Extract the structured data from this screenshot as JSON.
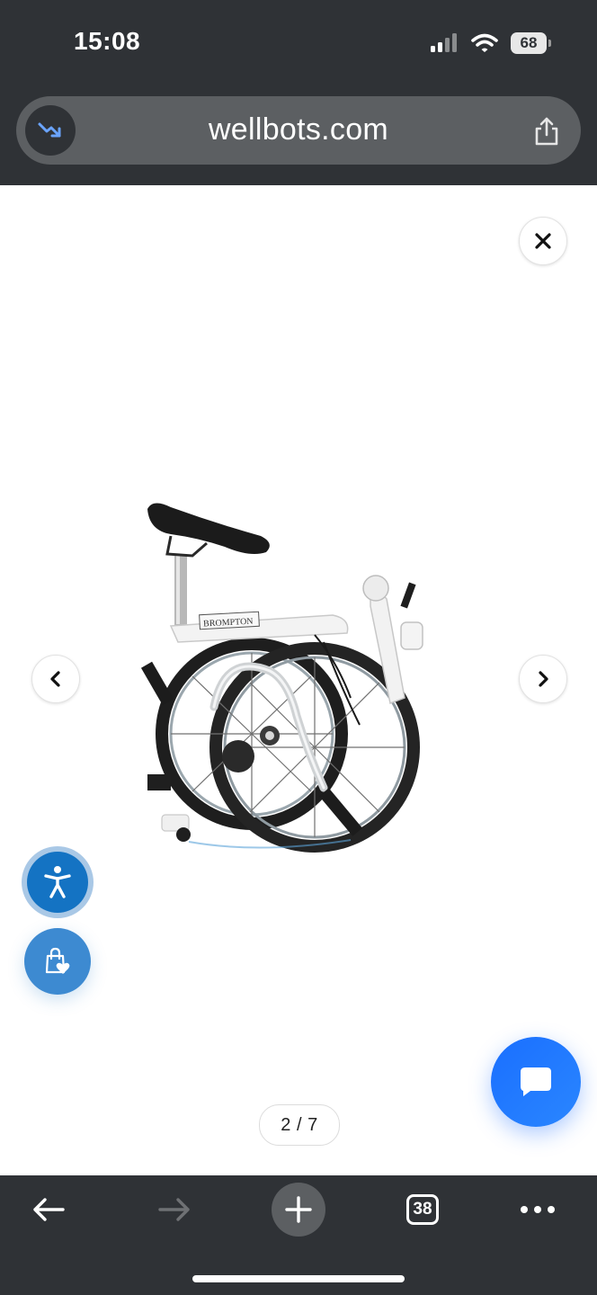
{
  "status_bar": {
    "time": "15:08",
    "battery": "68",
    "signal_icon": "cellular-signal-icon",
    "wifi_icon": "wifi-icon"
  },
  "browser": {
    "url": "wellbots.com",
    "trend_icon": "trending-down-icon",
    "share_icon": "share-icon"
  },
  "gallery": {
    "counter": "2 / 7",
    "brand_label": "BROMPTON",
    "close_icon": "close-icon",
    "prev_icon": "chevron-left-icon",
    "next_icon": "chevron-right-icon"
  },
  "floating": {
    "accessibility_icon": "accessibility-icon",
    "wishlist_icon": "shopping-bag-heart-icon",
    "chat_icon": "chat-bubble-icon"
  },
  "bottom_bar": {
    "tabs_count": "38",
    "back_icon": "arrow-left-icon",
    "forward_icon": "arrow-right-icon",
    "new_tab_icon": "plus-icon",
    "more_icon": "more-horizontal-icon"
  },
  "colors": {
    "chrome_bg": "#2f3236",
    "url_bar_bg": "#5c5f62",
    "accessibility_blue": "#1473c3",
    "wishlist_blue": "#3d8ad1",
    "chat_blue": "#1a6fff"
  }
}
